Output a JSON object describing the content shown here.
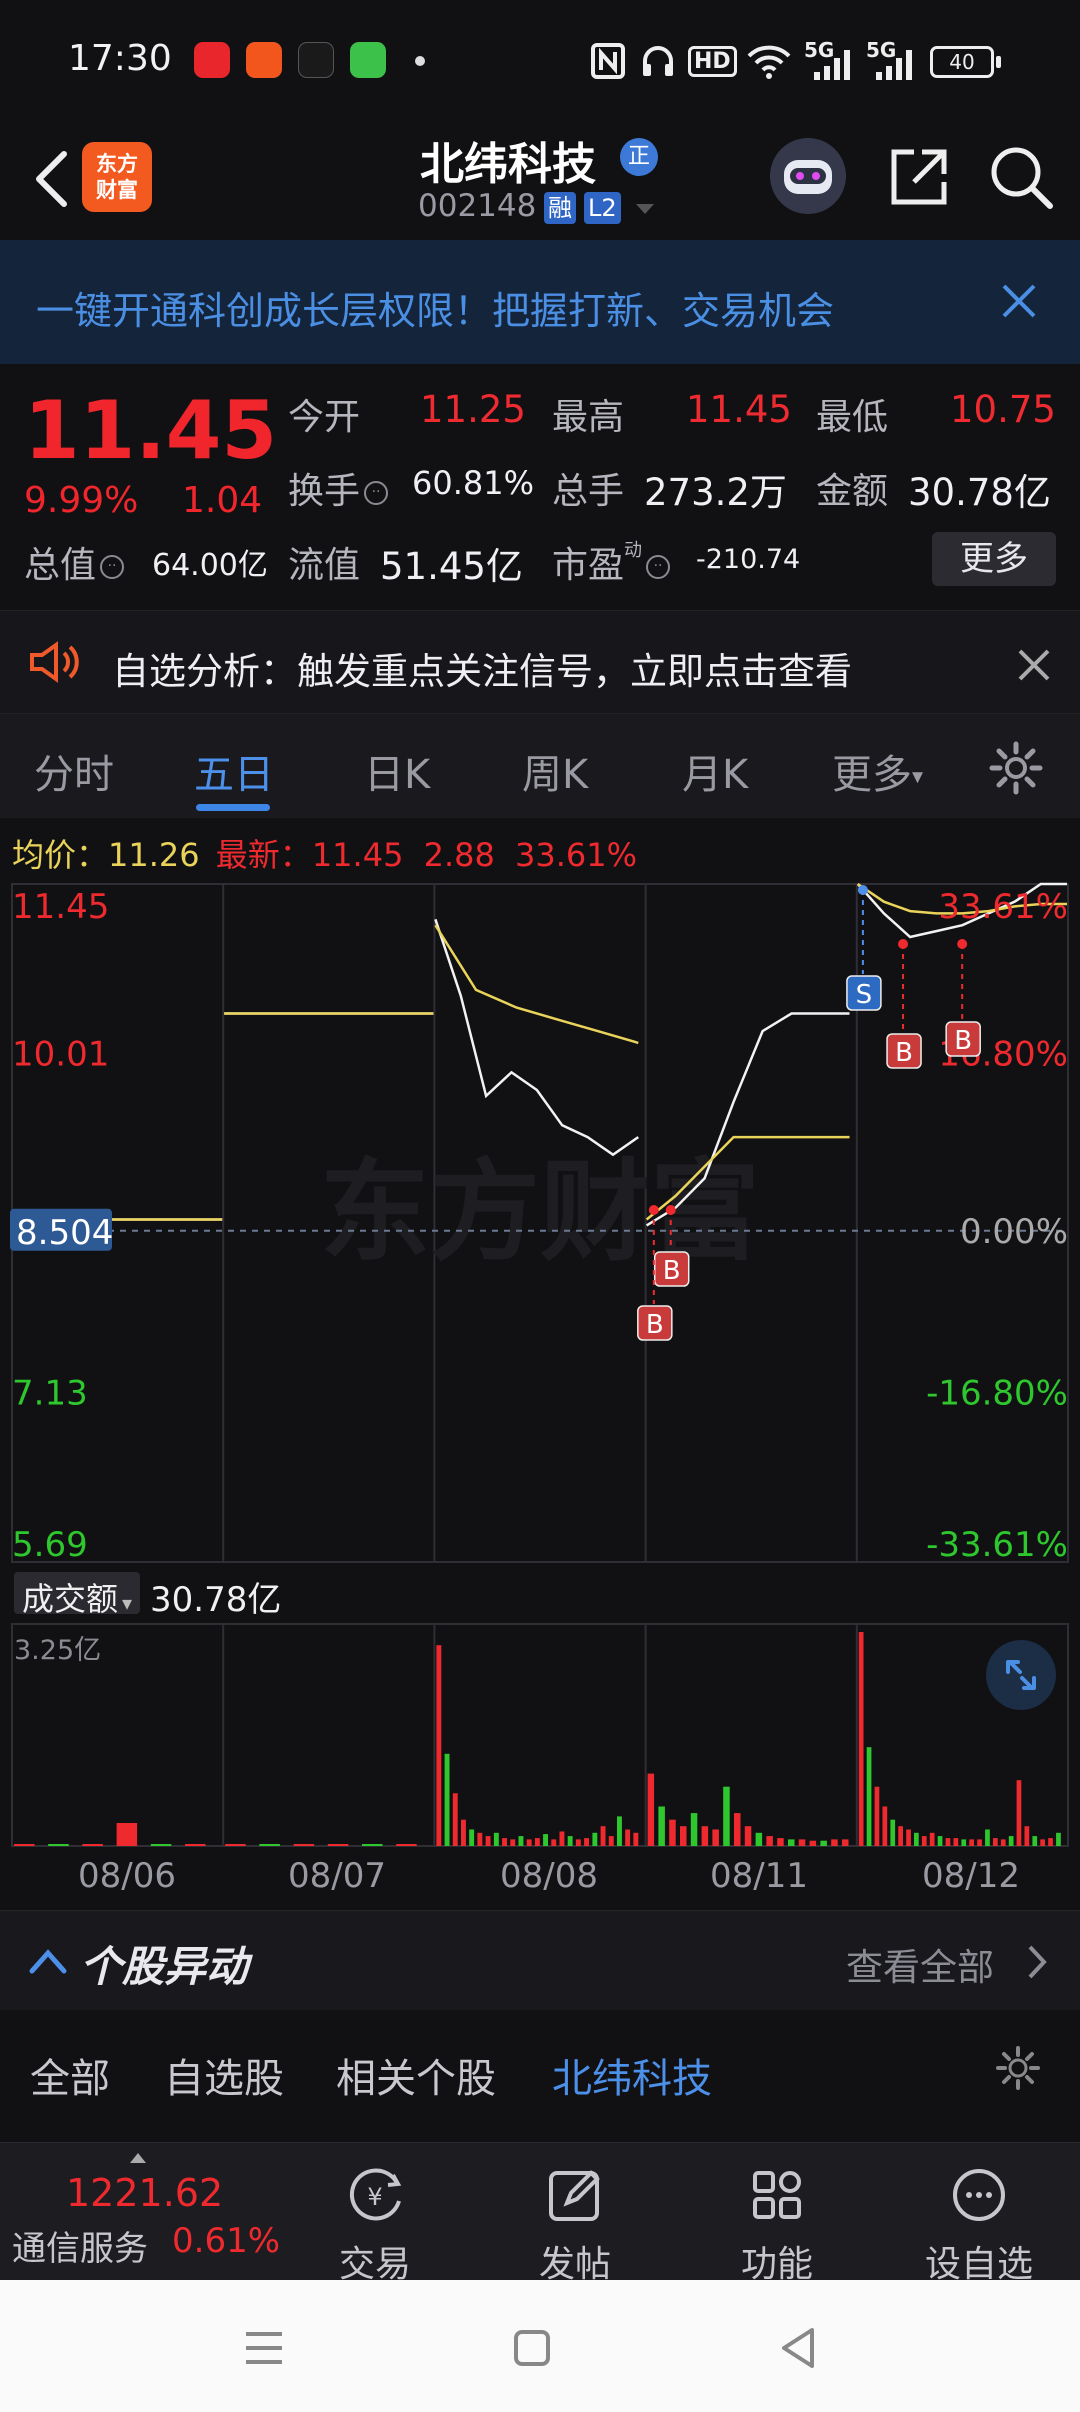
{
  "status_bar": {
    "time": "17:30",
    "dot": "•",
    "icons_right": [
      "nfc-icon",
      "headphones-icon",
      "hd-icon",
      "wifi-icon",
      "5g-signal-icon",
      "5g-signal-icon",
      "battery-icon"
    ],
    "hd_label": "HD",
    "net1": "5G",
    "net2": "5G",
    "battery": "40"
  },
  "header": {
    "logo_text_line1": "东方",
    "logo_text_line2": "财富",
    "stock_name": "北纬科技",
    "badge": "正",
    "stock_code": "002148",
    "tag_rong": "融",
    "tag_l2": "L2"
  },
  "banner": {
    "text": "一键开通科创成长层权限！把握打新、交易机会"
  },
  "quote": {
    "price": "11.45",
    "change_pct": "9.99%",
    "change": "1.04",
    "open_label": "今开",
    "open_value": "11.25",
    "high_label": "最高",
    "high_value": "11.45",
    "low_label": "最低",
    "low_value": "10.75",
    "turnover_label": "换手",
    "turnover_value": "60.81%",
    "volume_label": "总手",
    "volume_value": "273.2万",
    "amount_label": "金额",
    "amount_value": "30.78亿",
    "mktcap_label": "总值",
    "mktcap_value": "64.00亿",
    "float_label": "流值",
    "float_value": "51.45亿",
    "pe_label": "市盈",
    "pe_sup": "动",
    "pe_value": "-210.74",
    "more_button": "更多"
  },
  "alert": {
    "text": "自选分析：触发重点关注信号，立即点击查看"
  },
  "period_tabs": [
    {
      "label": "分时"
    },
    {
      "label": "五日"
    },
    {
      "label": "日K"
    },
    {
      "label": "周K"
    },
    {
      "label": "月K"
    },
    {
      "label": "更多"
    }
  ],
  "period_more_arrow": "▾",
  "active_period": "五日",
  "legend": {
    "avg_label": "均价：",
    "avg_value": "11.26",
    "last_label": "最新：",
    "last_value": "11.45",
    "last_change": "2.88",
    "last_pct": "33.61%"
  },
  "chart_data": {
    "type": "line",
    "y_ticks_left": [
      "11.45",
      "10.01",
      "8.504",
      "7.13",
      "5.69"
    ],
    "y_ticks_right": [
      "33.61%",
      "16.80%",
      "0.00%",
      "-16.80%",
      "-33.61%"
    ],
    "y_range": [
      5.69,
      11.45
    ],
    "base_price": 8.504,
    "x_days": [
      "08/06",
      "08/07",
      "08/08",
      "08/11",
      "08/12"
    ],
    "watermark": "东方财富",
    "series": [
      {
        "values_by_day": [
          [
            8.6,
            8.6,
            8.6,
            8.6
          ],
          [
            10.35,
            10.35,
            10.35,
            10.35
          ],
          [
            11.15,
            10.5,
            9.65,
            9.85,
            9.7,
            9.4,
            9.3,
            9.15,
            9.3
          ],
          [
            8.55,
            8.7,
            8.95,
            9.6,
            10.2,
            10.35,
            10.35,
            10.35
          ],
          [
            11.45,
            11.2,
            11.0,
            11.05,
            11.1,
            11.2,
            11.3,
            11.45,
            11.45
          ]
        ]
      },
      {
        "values_by_day": [
          [
            8.6,
            8.6,
            8.6,
            8.6
          ],
          [
            10.35,
            10.35,
            10.35,
            10.35
          ],
          [
            11.1,
            10.55,
            10.4,
            10.3,
            10.2,
            10.1
          ],
          [
            8.6,
            8.8,
            9.05,
            9.3,
            9.3,
            9.3,
            9.3,
            9.3
          ],
          [
            11.45,
            11.3,
            11.22,
            11.2,
            11.2,
            11.22,
            11.26,
            11.28,
            11.28
          ]
        ]
      }
    ],
    "signals": [
      {
        "label": "S",
        "day": 4,
        "pos": 0.01
      },
      {
        "label": "B",
        "day": 4,
        "pos": 0.2
      },
      {
        "label": "B",
        "day": 4,
        "pos": 0.48
      },
      {
        "label": "B",
        "day": 3,
        "pos": 0.1
      },
      {
        "label": "B",
        "day": 3,
        "pos": 0.02
      }
    ]
  },
  "volume": {
    "selector_label": "成交额",
    "selector_arrow": "▾",
    "total": "30.78亿",
    "max_label": "3.25亿",
    "max_value": 3.25
  },
  "volume_data": {
    "unit": "亿",
    "days": [
      [
        0.02,
        0.01,
        0.01,
        0.35,
        0.02,
        0.01
      ],
      [
        0.01,
        0.01,
        0.02,
        0.01,
        0.01,
        0.01
      ],
      [
        3.05,
        1.4,
        0.8,
        0.4,
        0.25,
        0.2,
        0.15,
        0.2,
        0.12,
        0.1,
        0.15,
        0.1,
        0.12,
        0.18,
        0.1,
        0.22,
        0.15,
        0.1,
        0.12,
        0.2,
        0.3,
        0.15,
        0.45,
        0.25,
        0.2
      ],
      [
        1.1,
        0.6,
        0.4,
        0.3,
        0.5,
        0.3,
        0.25,
        0.9,
        0.5,
        0.3,
        0.2,
        0.15,
        0.12,
        0.1,
        0.1,
        0.08,
        0.08,
        0.1,
        0.1
      ],
      [
        3.25,
        1.5,
        0.9,
        0.6,
        0.4,
        0.3,
        0.25,
        0.2,
        0.15,
        0.2,
        0.15,
        0.12,
        0.12,
        0.1,
        0.1,
        0.1,
        0.25,
        0.12,
        0.1,
        0.15,
        1.0,
        0.3,
        0.15,
        0.1,
        0.12,
        0.2
      ]
    ]
  },
  "movement": {
    "title": "个股异动",
    "view_all": "查看全部",
    "tabs": [
      "全部",
      "自选股",
      "相关个股",
      "北纬科技"
    ],
    "active_tab": "北纬科技"
  },
  "bottom_bar": {
    "index_value": "1221.62",
    "index_name": "通信服务",
    "index_change": "0.61%",
    "items": [
      {
        "label": "交易",
        "icon": "trade-icon"
      },
      {
        "label": "发帖",
        "icon": "edit-icon"
      },
      {
        "label": "功能",
        "icon": "grid-icon"
      },
      {
        "label": "设自选",
        "icon": "more-dots-icon"
      }
    ]
  },
  "colors": {
    "red": "#ef2a2f",
    "green": "#2ec82e",
    "blue": "#4c90ea",
    "avg_line": "#e9d35a",
    "bg": "#111114"
  }
}
